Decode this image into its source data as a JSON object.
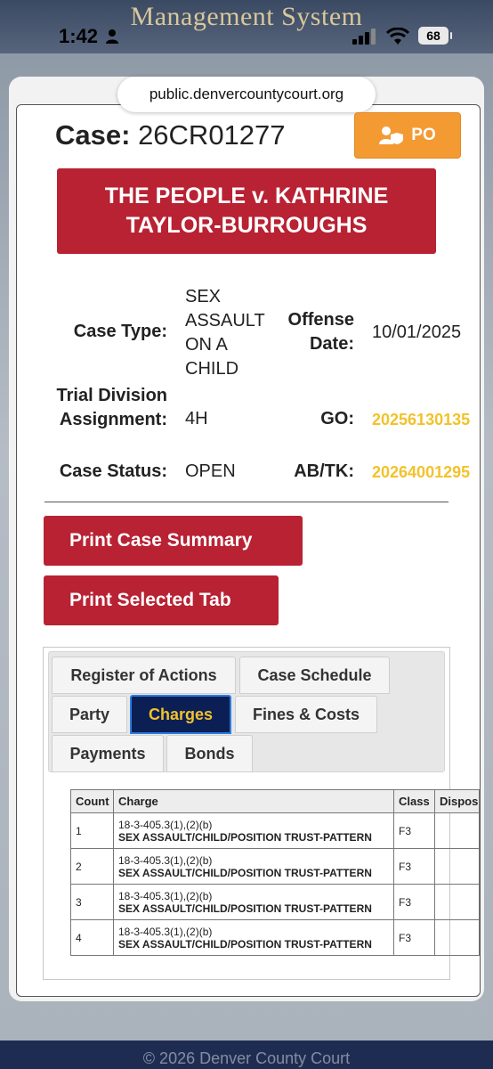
{
  "background": {
    "heading": "Management System",
    "footer_text": "© 2026 Denver County Court"
  },
  "status_bar": {
    "time": "1:42",
    "battery": "68"
  },
  "browser": {
    "url": "public.denvercountycourt.org"
  },
  "case": {
    "label": "Case:",
    "number": "26CR01277",
    "po_label": "PO",
    "title": "THE PEOPLE v. KATHRINE TAYLOR-BURROUGHS"
  },
  "info": {
    "case_type_label": "Case Type:",
    "case_type_value": "SEX ASSAULT ON A CHILD",
    "offense_date_label": "Offense Date:",
    "offense_date_value": "10/01/2025",
    "trial_division_label": "Trial Division Assignment:",
    "trial_division_value": "4H",
    "go_label": "GO:",
    "go_value": "20256130135",
    "case_status_label": "Case Status:",
    "case_status_value": "OPEN",
    "abtk_label": "AB/TK:",
    "abtk_value": "20264001295"
  },
  "buttons": {
    "print_summary": "Print Case Summary",
    "print_tab": "Print Selected Tab"
  },
  "tabs": {
    "register": "Register of Actions",
    "schedule": "Case Schedule",
    "party": "Party",
    "charges": "Charges",
    "fines": "Fines & Costs",
    "payments": "Payments",
    "bonds": "Bonds"
  },
  "charges_table": {
    "headers": [
      "Count",
      "Charge",
      "Class",
      "Disposition"
    ],
    "rows": [
      {
        "count": "1",
        "statute": "18-3-405.3(1),(2)(b)",
        "desc": "SEX ASSAULT/CHILD/POSITION TRUST-PATTERN",
        "class": "F3",
        "disposition": ""
      },
      {
        "count": "2",
        "statute": "18-3-405.3(1),(2)(b)",
        "desc": "SEX ASSAULT/CHILD/POSITION TRUST-PATTERN",
        "class": "F3",
        "disposition": ""
      },
      {
        "count": "3",
        "statute": "18-3-405.3(1),(2)(b)",
        "desc": "SEX ASSAULT/CHILD/POSITION TRUST-PATTERN",
        "class": "F3",
        "disposition": ""
      },
      {
        "count": "4",
        "statute": "18-3-405.3(1),(2)(b)",
        "desc": "SEX ASSAULT/CHILD/POSITION TRUST-PATTERN",
        "class": "F3",
        "disposition": ""
      }
    ]
  },
  "colors": {
    "accent_red": "#b82233",
    "po_orange": "#f49a33",
    "tab_active_bg": "#0b1f55",
    "highlight_gold": "#f2c22b"
  }
}
